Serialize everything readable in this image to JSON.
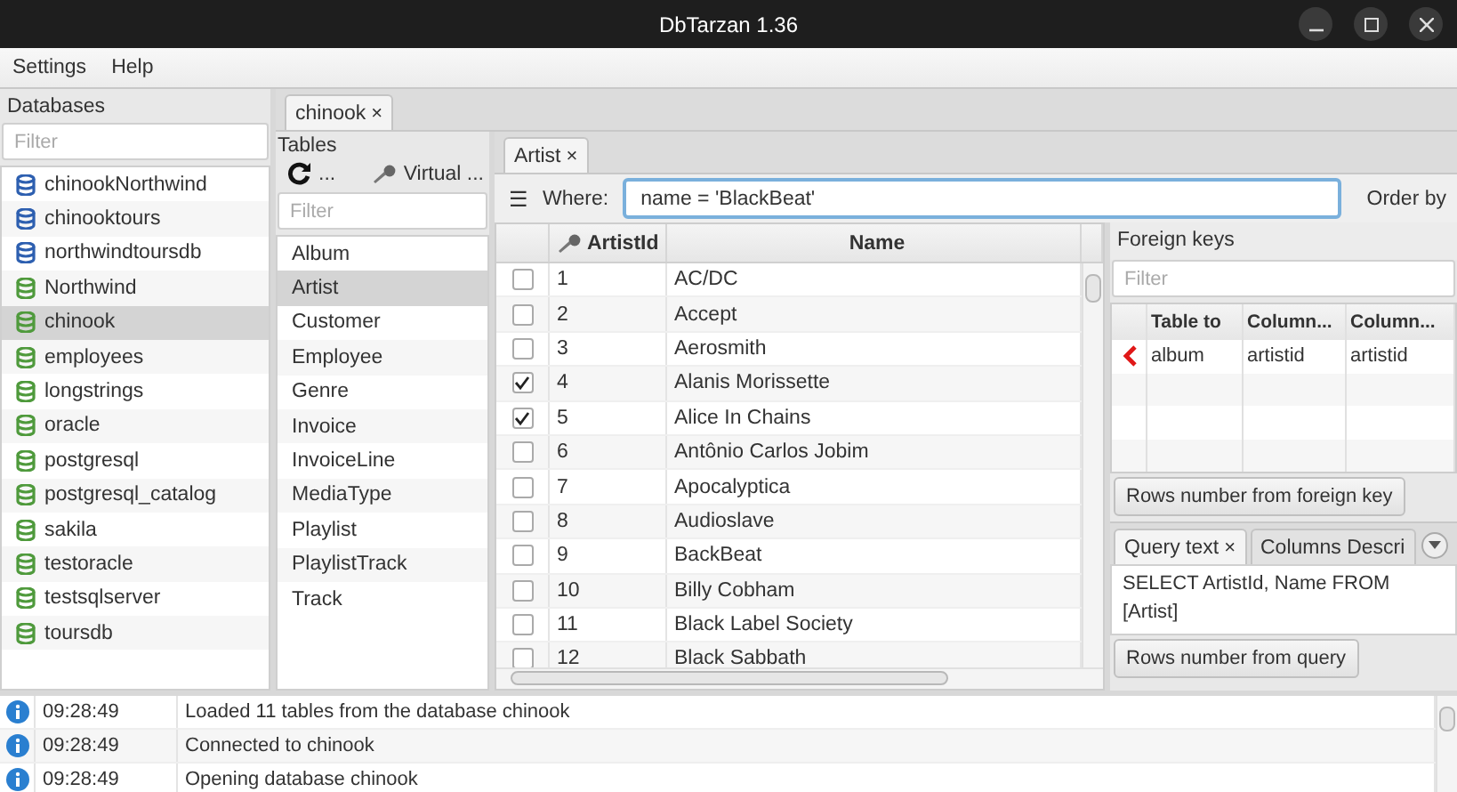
{
  "window": {
    "title": "DbTarzan 1.36"
  },
  "menu": [
    "Settings",
    "Help"
  ],
  "databases": {
    "title": "Databases",
    "filter_placeholder": "Filter",
    "items": [
      {
        "name": "chinookNorthwind",
        "color": "#2d5fb0",
        "selected": false
      },
      {
        "name": "chinooktours",
        "color": "#2d5fb0",
        "selected": false
      },
      {
        "name": "northwindtoursdb",
        "color": "#2d5fb0",
        "selected": false
      },
      {
        "name": "Northwind",
        "color": "#4f9a3c",
        "selected": false
      },
      {
        "name": "chinook",
        "color": "#4f9a3c",
        "selected": true
      },
      {
        "name": "employees",
        "color": "#4f9a3c",
        "selected": false
      },
      {
        "name": "longstrings",
        "color": "#4f9a3c",
        "selected": false
      },
      {
        "name": "oracle",
        "color": "#4f9a3c",
        "selected": false
      },
      {
        "name": "postgresql",
        "color": "#4f9a3c",
        "selected": false
      },
      {
        "name": "postgresql_catalog",
        "color": "#4f9a3c",
        "selected": false
      },
      {
        "name": "sakila",
        "color": "#4f9a3c",
        "selected": false
      },
      {
        "name": "testoracle",
        "color": "#4f9a3c",
        "selected": false
      },
      {
        "name": "testsqlserver",
        "color": "#4f9a3c",
        "selected": false
      },
      {
        "name": "toursdb",
        "color": "#4f9a3c",
        "selected": false
      }
    ]
  },
  "db_tabs": [
    {
      "label": "chinook",
      "close": "×",
      "selected": true
    }
  ],
  "tables": {
    "title": "Tables",
    "refresh_label": "...",
    "virtual_label": "Virtual ...",
    "filter_placeholder": "Filter",
    "items": [
      {
        "name": "Album",
        "selected": false
      },
      {
        "name": "Artist",
        "selected": true
      },
      {
        "name": "Customer",
        "selected": false
      },
      {
        "name": "Employee",
        "selected": false
      },
      {
        "name": "Genre",
        "selected": false
      },
      {
        "name": "Invoice",
        "selected": false
      },
      {
        "name": "InvoiceLine",
        "selected": false
      },
      {
        "name": "MediaType",
        "selected": false
      },
      {
        "name": "Playlist",
        "selected": false
      },
      {
        "name": "PlaylistTrack",
        "selected": false
      },
      {
        "name": "Track",
        "selected": false
      }
    ]
  },
  "table_tabs": [
    {
      "label": "Artist",
      "close": "×",
      "selected": true
    }
  ],
  "query_bar": {
    "menu_glyph": "☰",
    "where_label": "Where:",
    "where_value": "name = 'BlackBeat'",
    "order_label": "Order by"
  },
  "grid": {
    "columns": [
      "ArtistId",
      "Name"
    ],
    "rows": [
      {
        "checked": false,
        "id": "1",
        "name": "AC/DC"
      },
      {
        "checked": false,
        "id": "2",
        "name": "Accept"
      },
      {
        "checked": false,
        "id": "3",
        "name": "Aerosmith"
      },
      {
        "checked": true,
        "id": "4",
        "name": "Alanis Morissette"
      },
      {
        "checked": true,
        "id": "5",
        "name": "Alice In Chains"
      },
      {
        "checked": false,
        "id": "6",
        "name": "Antônio Carlos Jobim"
      },
      {
        "checked": false,
        "id": "7",
        "name": "Apocalyptica"
      },
      {
        "checked": false,
        "id": "8",
        "name": "Audioslave"
      },
      {
        "checked": false,
        "id": "9",
        "name": "BackBeat"
      },
      {
        "checked": false,
        "id": "10",
        "name": "Billy Cobham"
      },
      {
        "checked": false,
        "id": "11",
        "name": "Black Label Society"
      },
      {
        "checked": false,
        "id": "12",
        "name": "Black Sabbath"
      }
    ]
  },
  "foreign_keys": {
    "title": "Foreign keys",
    "filter_placeholder": "Filter",
    "columns": [
      "Table to",
      "Column...",
      "Column..."
    ],
    "rows": [
      {
        "table_to": "album",
        "column_from": "artistid",
        "column_to": "artistid"
      }
    ],
    "button": "Rows number from foreign key"
  },
  "info_tabs": [
    {
      "label": "Query text",
      "close": "×",
      "selected": true
    },
    {
      "label": "Columns Descri",
      "selected": false
    }
  ],
  "query_text": "SELECT ArtistId, Name FROM [Artist]",
  "query_button": "Rows number from query",
  "log": [
    {
      "time": "09:28:49",
      "message": "Loaded 11 tables from the database chinook"
    },
    {
      "time": "09:28:49",
      "message": "Connected to chinook"
    },
    {
      "time": "09:28:49",
      "message": "Opening database chinook"
    }
  ]
}
